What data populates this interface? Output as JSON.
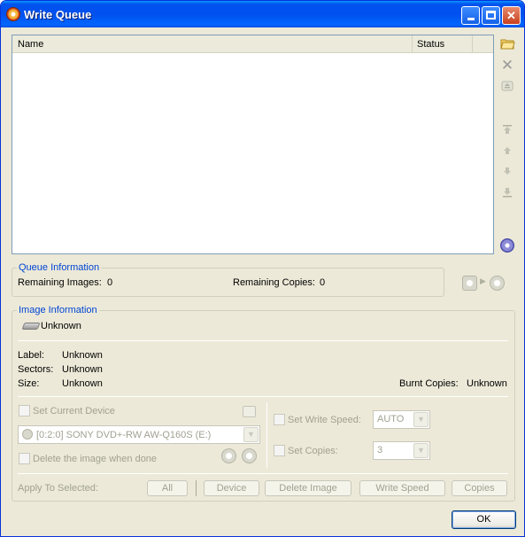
{
  "window": {
    "title": "Write Queue"
  },
  "list": {
    "columns": [
      "Name",
      "Status"
    ]
  },
  "side_icons": [
    "open-folder-icon",
    "delete-icon",
    "eject-icon",
    "move-top-icon",
    "move-up-icon",
    "move-down-icon",
    "move-bottom-icon",
    "burn-disc-icon"
  ],
  "queue_info": {
    "title": "Queue Information",
    "remaining_images_label": "Remaining Images:",
    "remaining_images_value": "0",
    "remaining_copies_label": "Remaining Copies:",
    "remaining_copies_value": "0"
  },
  "image_info": {
    "title": "Image Information",
    "name": "Unknown",
    "label_label": "Label:",
    "label_value": "Unknown",
    "sectors_label": "Sectors:",
    "sectors_value": "Unknown",
    "size_label": "Size:",
    "size_value": "Unknown",
    "burnt_copies_label": "Burnt Copies:",
    "burnt_copies_value": "Unknown"
  },
  "options": {
    "set_current_device": "Set Current Device",
    "device_selected": "[0:2:0] SONY DVD+-RW AW-Q160S (E:)",
    "delete_when_done": "Delete the image when done",
    "set_write_speed": "Set Write Speed:",
    "write_speed_value": "AUTO",
    "set_copies": "Set Copies:",
    "copies_value": "3"
  },
  "apply": {
    "label": "Apply To Selected:",
    "all": "All",
    "device": "Device",
    "delete_image": "Delete Image",
    "write_speed": "Write Speed",
    "copies": "Copies"
  },
  "ok_label": "OK"
}
